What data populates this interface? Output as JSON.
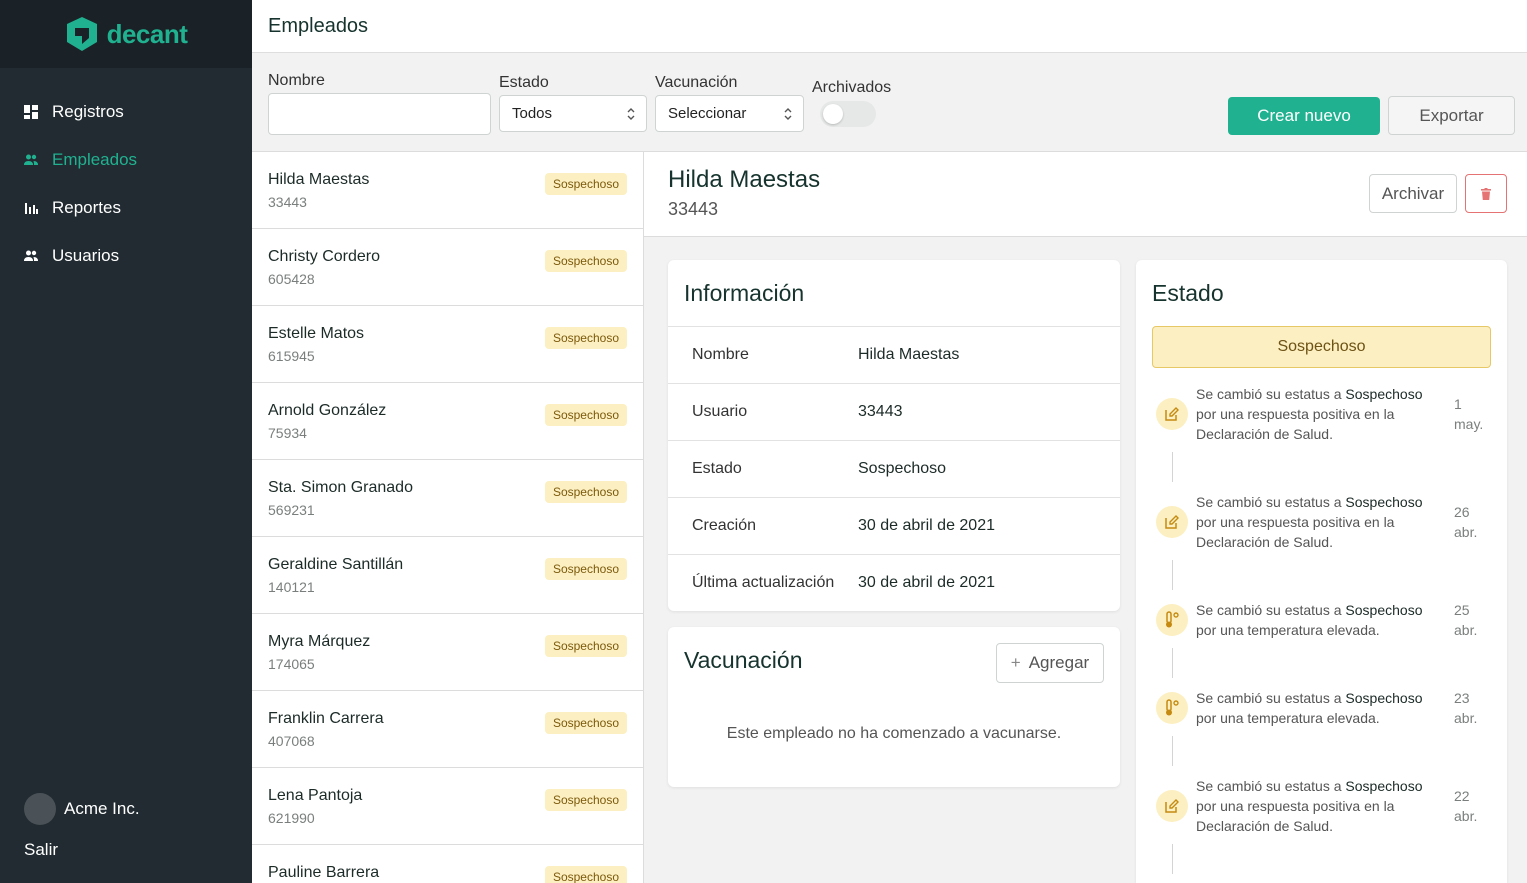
{
  "brand": {
    "name": "decant",
    "color": "#20b290"
  },
  "nav": [
    {
      "label": "Registros",
      "icon": "grid-icon",
      "active": false
    },
    {
      "label": "Empleados",
      "icon": "people-icon",
      "active": true
    },
    {
      "label": "Reportes",
      "icon": "bar-chart-icon",
      "active": false
    },
    {
      "label": "Usuarios",
      "icon": "people-icon",
      "active": false
    }
  ],
  "org": {
    "name": "Acme Inc."
  },
  "logout_label": "Salir",
  "page_title": "Empleados",
  "filters": {
    "name_label": "Nombre",
    "name_value": "",
    "status_label": "Estado",
    "status_value": "Todos",
    "vaccination_label": "Vacunación",
    "vaccination_value": "Seleccionar",
    "archived_label": "Archivados",
    "archived_on": false
  },
  "actions": {
    "create_label": "Crear nuevo",
    "export_label": "Exportar"
  },
  "employees": [
    {
      "name": "Hilda Maestas",
      "id": "33443",
      "status": "Sospechoso"
    },
    {
      "name": "Christy Cordero",
      "id": "605428",
      "status": "Sospechoso"
    },
    {
      "name": "Estelle Matos",
      "id": "615945",
      "status": "Sospechoso"
    },
    {
      "name": "Arnold González",
      "id": "75934",
      "status": "Sospechoso"
    },
    {
      "name": "Sta. Simon Granado",
      "id": "569231",
      "status": "Sospechoso"
    },
    {
      "name": "Geraldine Santillán",
      "id": "140121",
      "status": "Sospechoso"
    },
    {
      "name": "Myra Márquez",
      "id": "174065",
      "status": "Sospechoso"
    },
    {
      "name": "Franklin Carrera",
      "id": "407068",
      "status": "Sospechoso"
    },
    {
      "name": "Lena Pantoja",
      "id": "621990",
      "status": "Sospechoso"
    },
    {
      "name": "Pauline Barrera",
      "id": "",
      "status": "Sospechoso"
    }
  ],
  "detail": {
    "name": "Hilda Maestas",
    "id": "33443",
    "archive_label": "Archivar",
    "info_title": "Información",
    "info": [
      {
        "key": "Nombre",
        "value": "Hilda Maestas"
      },
      {
        "key": "Usuario",
        "value": "33443"
      },
      {
        "key": "Estado",
        "value": "Sospechoso"
      },
      {
        "key": "Creación",
        "value": "30 de abril de 2021"
      },
      {
        "key": "Última actualización",
        "value": "30 de abril de 2021"
      }
    ],
    "vaccination_title": "Vacunación",
    "add_label": "Agregar",
    "vaccination_empty": "Este empleado no ha comenzado a vacunarse.",
    "status_title": "Estado",
    "status_value": "Sospechoso",
    "timeline": [
      {
        "icon": "edit-icon",
        "prefix": "Se cambió su estatus a ",
        "status": "Sospechoso",
        "rest": " por una respuesta positiva en la Declaración de Salud.",
        "day": "1",
        "month": "may."
      },
      {
        "icon": "edit-icon",
        "prefix": "Se cambió su estatus a ",
        "status": "Sospechoso",
        "rest": " por una respuesta positiva en la Declaración de Salud.",
        "day": "26",
        "month": "abr."
      },
      {
        "icon": "thermometer-icon",
        "prefix": "Se cambió su estatus a ",
        "status": "Sospechoso",
        "rest": " por una temperatura elevada.",
        "day": "25",
        "month": "abr."
      },
      {
        "icon": "thermometer-icon",
        "prefix": "Se cambió su estatus a ",
        "status": "Sospechoso",
        "rest": " por una temperatura elevada.",
        "day": "23",
        "month": "abr."
      },
      {
        "icon": "edit-icon",
        "prefix": "Se cambió su estatus a ",
        "status": "Sospechoso",
        "rest": " por una respuesta positiva en la Declaración de Salud.",
        "day": "22",
        "month": "abr."
      }
    ]
  }
}
